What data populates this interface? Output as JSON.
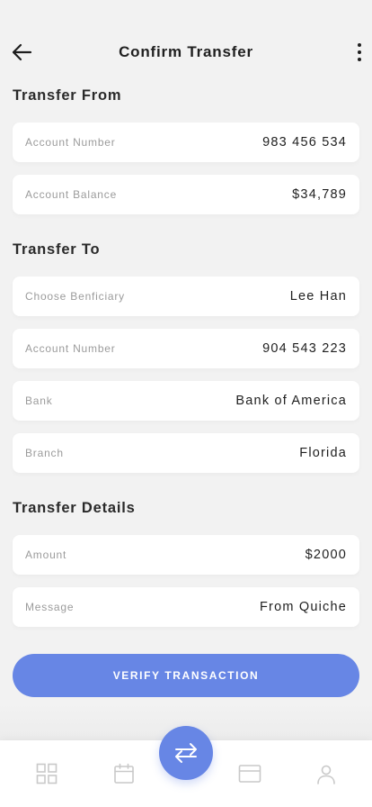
{
  "header": {
    "title": "Confirm Transfer",
    "back_icon": "arrow-left-icon",
    "menu_icon": "more-vertical-icon"
  },
  "transfer_from": {
    "title": "Transfer From",
    "fields": [
      {
        "label": "Account Number",
        "value": "983 456 534"
      },
      {
        "label": "Account Balance",
        "value": "$34,789"
      }
    ]
  },
  "transfer_to": {
    "title": "Transfer To",
    "fields": [
      {
        "label": "Choose Benficiary",
        "value": "Lee Han"
      },
      {
        "label": "Account Number",
        "value": "904 543 223"
      },
      {
        "label": "Bank",
        "value": "Bank of America"
      },
      {
        "label": "Branch",
        "value": "Florida"
      }
    ]
  },
  "transfer_details": {
    "title": "Transfer Details",
    "fields": [
      {
        "label": "Amount",
        "value": "$2000"
      },
      {
        "label": "Message",
        "value": "From Quiche"
      }
    ]
  },
  "verify_button": {
    "label": "VERIFY TRANSACTION"
  },
  "bottom_nav": {
    "items": [
      {
        "icon": "grid-icon"
      },
      {
        "icon": "calendar-icon"
      },
      {
        "icon": "card-icon"
      },
      {
        "icon": "profile-icon"
      }
    ],
    "center_action_icon": "transfer-arrows-icon"
  },
  "colors": {
    "accent": "#6786e5",
    "background": "#f2f2f2",
    "card": "#ffffff",
    "label": "#9b9b9b",
    "text": "#1f1f1f",
    "nav_icon": "#c9c9c9"
  }
}
